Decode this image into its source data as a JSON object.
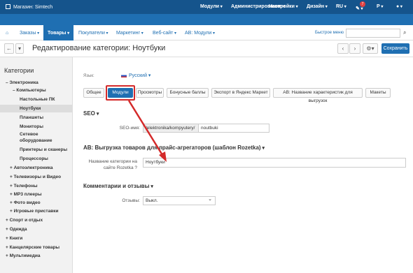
{
  "topbar": {
    "store": "Магазин: Simtech",
    "menus": [
      "Модули",
      "Администрирование",
      "Настройки",
      "Дизайн",
      "RU",
      "Р"
    ],
    "notif_count": "7",
    "user_icon": "user-icon"
  },
  "nav": {
    "items": [
      "Заказы",
      "Товары",
      "Покупатели",
      "Маркетинг",
      "Веб-сайт",
      "AB: Модули"
    ],
    "quick_menu": "Быстрое меню",
    "search_placeholder": ""
  },
  "titlebar": {
    "title": "Редактирование категории: Ноутбуки",
    "save": "Сохранить"
  },
  "sidebar": {
    "heading": "Категории",
    "items": [
      "Электроника",
      "Компьютеры",
      "Настольные ПК",
      "Ноутбуки",
      "Планшеты",
      "Мониторы",
      "Сетевое",
      "оборудование",
      "Принтеры и сканеры",
      "Процессоры",
      "Автоэлектроника",
      "Телевизоры и Видео",
      "Телефоны",
      "MP3 плееры",
      "Фото видео",
      "Игровые приставки",
      "Спорт и отдых",
      "Одежда",
      "Книги",
      "Канцелярские товары",
      "Мультимедиа"
    ]
  },
  "main": {
    "lang_label": "Язык:",
    "lang_value": "Русский",
    "tabs": [
      "Общее",
      "Модули",
      "Просмотры",
      "Бонусные баллы",
      "Экспорт в Яндекс Маркет",
      "AB: Название характеристик для выгрузок",
      "Макеты"
    ],
    "seo_section": "SEO",
    "seo_label": "SEO-имя:",
    "seo_prefix": "/elektronika/kompyutery/",
    "seo_value": "noutbuki",
    "rozetka_section": "AB: Выгрузка товаров для прайс-агрегаторов (шаблон Rozetka)",
    "rozetka_label_1": "Название категории на",
    "rozetka_label_2": "сайте Rozetka",
    "rozetka_value": "Ноутбуки",
    "comments_section": "Комментарии и отзывы",
    "reviews_label": "Отзывы:",
    "reviews_value": "Выкл."
  },
  "colors": {
    "accent": "#1f6fb2",
    "annotation": "#d42a2a"
  }
}
